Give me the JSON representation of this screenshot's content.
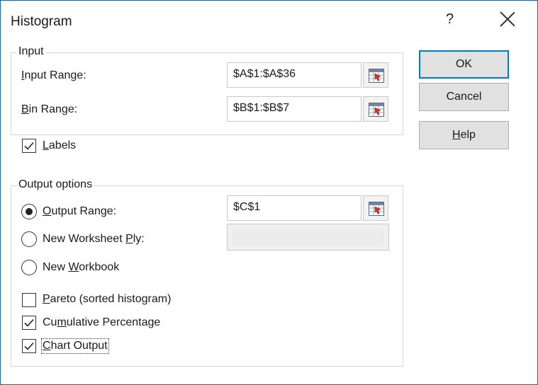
{
  "window": {
    "title": "Histogram",
    "help_glyph": "?"
  },
  "input_group": {
    "legend": "Input",
    "input_range": {
      "label_pre": "",
      "label_mnemonic": "I",
      "label_post": "nput Range:",
      "value": "$A$1:$A$36"
    },
    "bin_range": {
      "label_pre": "",
      "label_mnemonic": "B",
      "label_post": "in Range:",
      "value": "$B$1:$B$7"
    }
  },
  "labels_checkbox": {
    "checked": true,
    "label_pre": "",
    "label_mnemonic": "L",
    "label_post": "abels"
  },
  "output_group": {
    "legend": "Output options",
    "output_range": {
      "selected": true,
      "label_pre": "",
      "label_mnemonic": "O",
      "label_post": "utput Range:",
      "value": "$C$1"
    },
    "new_worksheet": {
      "selected": false,
      "label_pre": "New Worksheet ",
      "label_mnemonic": "P",
      "label_post": "ly:",
      "value": ""
    },
    "new_workbook": {
      "selected": false,
      "label_pre": "New ",
      "label_mnemonic": "W",
      "label_post": "orkbook"
    }
  },
  "options": {
    "pareto": {
      "checked": false,
      "label_pre": "",
      "label_mnemonic": "P",
      "label_post": "areto (sorted histogram)"
    },
    "cumulative": {
      "checked": true,
      "label_pre": "Cu",
      "label_mnemonic": "m",
      "label_post": "ulative Percentage"
    },
    "chart_output": {
      "checked": true,
      "label_pre": "",
      "label_mnemonic": "C",
      "label_post": "hart Output"
    }
  },
  "buttons": {
    "ok": "OK",
    "cancel": "Cancel",
    "help_mnemonic": "H",
    "help_post": "elp"
  },
  "colors": {
    "accent": "#0078d7",
    "window_border": "#1f5fa6",
    "button_face": "#e1e1e1"
  },
  "icons": {
    "close": "close-icon",
    "range_selector": "collapse-dialog-icon",
    "checkmark": "checkmark-icon"
  }
}
